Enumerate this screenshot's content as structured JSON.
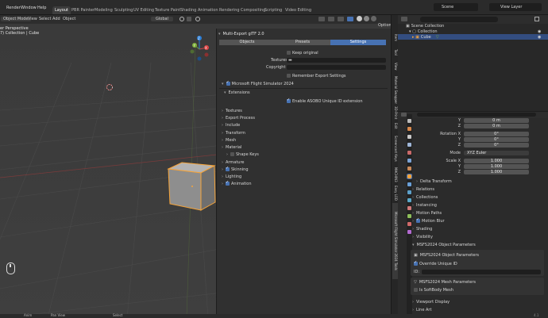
{
  "menubar": {
    "items": [
      "Render",
      "Window",
      "Help"
    ],
    "workspaces": [
      "Layout",
      "PBR Painter",
      "Modeling",
      "Sculpting",
      "UV Editing",
      "Texture Paint",
      "Shading",
      "Animation",
      "Rendering",
      "Compositing",
      "Scripting",
      "Video Editing"
    ],
    "scene_label": "Scene",
    "view_layer_label": "View Layer"
  },
  "viewport_header": {
    "mode": "Object Mode",
    "menus": [
      "View",
      "Select",
      "Add",
      "Object"
    ],
    "orientation": "Global",
    "options": "Options"
  },
  "viewport_info": {
    "line1": "er Perspective",
    "line2": "7) Collection | Cube"
  },
  "gizmo": {
    "x": "X",
    "y": "Y",
    "z": "Z"
  },
  "export_dialog": {
    "title": "Multi-Export glTF 2.0",
    "tabs": [
      "Objects",
      "Presets",
      "Settings"
    ],
    "keep_original": "Keep original",
    "textures_label": "Textures",
    "copyright_label": "Copyright",
    "remember_settings": "Remember Export Settings",
    "msfs_section": "Microsoft Flight Simulator 2024",
    "extensions_label": "Extensions",
    "unique_id": "Enable ASOBO Unique ID extension",
    "panels": [
      "Textures",
      "Export Process",
      "Include",
      "Transform",
      "Mesh",
      "Material",
      "Shape Keys",
      "Armature",
      "Skinning",
      "Lighting",
      "Animation"
    ]
  },
  "vtabs": [
    "Item",
    "Tool",
    "View",
    "Material Swapper",
    "3D-Print",
    "Edit",
    "Screencast Keys",
    "MACHIN3",
    "Easy LOD",
    "Microsoft Flight Simulator 2024 Tools"
  ],
  "outliner": {
    "scene_collection": "Scene Collection",
    "collection": "Collection",
    "cube": "Cube"
  },
  "properties": {
    "loc_y_label": "Y",
    "loc_y": "0 m",
    "loc_z_label": "Z",
    "loc_z": "0 m",
    "rotation_label": "Rotation X",
    "rot_x": "0°",
    "rot_y_label": "Y",
    "rot_y": "0°",
    "rot_z_label": "Z",
    "rot_z": "0°",
    "mode_label": "Mode",
    "mode_value": "XYZ Euler",
    "scale_label": "Scale X",
    "scale_x": "1.000",
    "scale_y_label": "Y",
    "scale_y": "1.000",
    "scale_z_label": "Z",
    "scale_z": "1.000",
    "delta": "Delta Transform",
    "sections": [
      "Relations",
      "Collections",
      "Instancing",
      "Motion Paths"
    ],
    "motion_blur": "Motion Blur",
    "sections2": [
      "Shading",
      "Visibility"
    ],
    "msfs_obj_params": "MSFS2024 Object Parameters",
    "msfs_obj_inner": "MSFS2024 Object Parameters",
    "override_id": "Override Unique ID",
    "id_label": "ID:",
    "msfs_mesh": "MSFS2024 Mesh Parameters",
    "softbody": "Is SoftBody Mesh",
    "viewport_display": "Viewport Display",
    "line_art": "Line Art"
  },
  "statusbar": {
    "left": "Anim",
    "mid": "Pan View",
    "right": "Select",
    "version": "4.1"
  },
  "colors": {
    "accent": "#4772b3",
    "selection": "#f5a43a",
    "grid": "#464646"
  }
}
